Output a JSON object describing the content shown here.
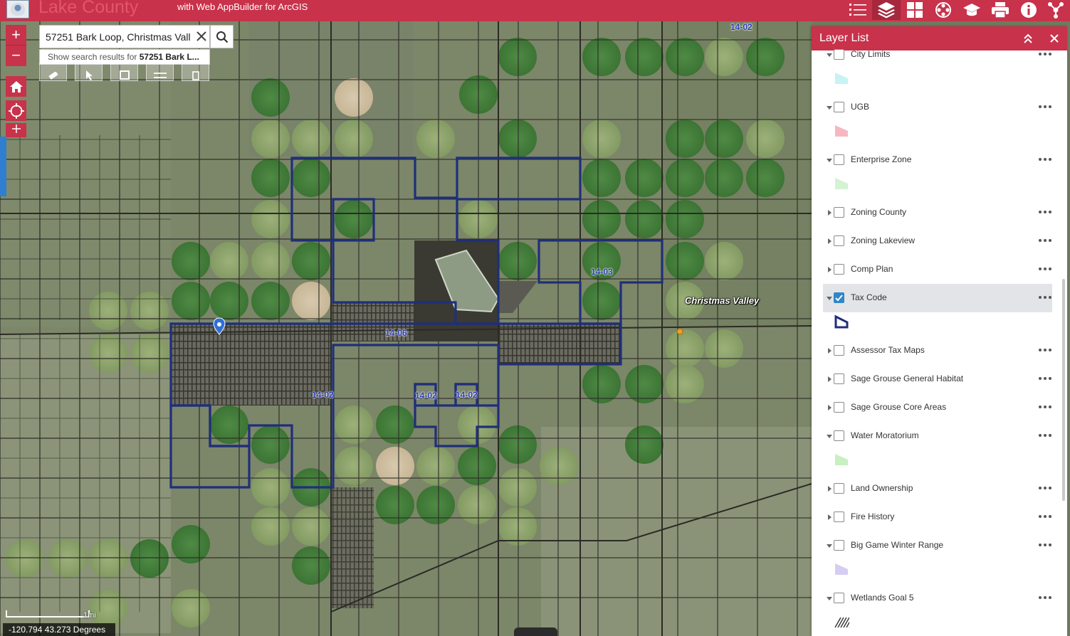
{
  "header": {
    "title": "Lake County",
    "subtitle": "with Web AppBuilder for ArcGIS",
    "toolbar": [
      {
        "name": "legend-icon",
        "active": false
      },
      {
        "name": "layers-icon",
        "active": true
      },
      {
        "name": "basemap-gallery-icon",
        "active": false
      },
      {
        "name": "film-reel-icon",
        "active": false
      },
      {
        "name": "graduation-cap-icon",
        "active": false
      },
      {
        "name": "print-icon",
        "active": false
      },
      {
        "name": "info-icon",
        "active": false
      },
      {
        "name": "share-icon",
        "active": false
      }
    ]
  },
  "search": {
    "value": "57251 Bark Loop, Christmas Vall",
    "suggestion_prefix": "Show search results for ",
    "suggestion_term": "57251 Bark L..."
  },
  "map": {
    "tax_code_labels": [
      "14-02",
      "14-03",
      "14-06",
      "14-02",
      "14-02",
      "14-02"
    ],
    "place_label": "Christmas Valley",
    "scale_label": "1mi",
    "coordinates": "-120.794 43.273 Degrees",
    "zoom_in": "+",
    "zoom_out": "−",
    "colors": {
      "tax_boundary": "#1f2f7a",
      "parcel_lines": "#2a2a26",
      "place_marker": "#f0a020",
      "search_pin": "#2f6fd6"
    }
  },
  "layer_list": {
    "title": "Layer List",
    "layers": [
      {
        "label": "City Limits",
        "expanded": true,
        "checked": false,
        "symbol": "fill",
        "color": "#c8f2f4"
      },
      {
        "label": "UGB",
        "expanded": true,
        "checked": false,
        "symbol": "fill",
        "color": "#f6b8c0"
      },
      {
        "label": "Enterprise Zone",
        "expanded": true,
        "checked": false,
        "symbol": "fill",
        "color": "#d4f2d4"
      },
      {
        "label": "Zoning County",
        "expanded": false,
        "checked": false
      },
      {
        "label": "Zoning Lakeview",
        "expanded": false,
        "checked": false
      },
      {
        "label": "Comp Plan",
        "expanded": false,
        "checked": false
      },
      {
        "label": "Tax Code",
        "expanded": true,
        "checked": true,
        "selected": true,
        "symbol": "outline",
        "color": "#1f2f7a"
      },
      {
        "label": "Assessor Tax Maps",
        "expanded": false,
        "checked": false
      },
      {
        "label": "Sage Grouse General Habitat",
        "expanded": false,
        "checked": false
      },
      {
        "label": "Sage Grouse Core Areas",
        "expanded": false,
        "checked": false
      },
      {
        "label": "Water Moratorium",
        "expanded": true,
        "checked": false,
        "symbol": "fill",
        "color": "#c8f0c0"
      },
      {
        "label": "Land Ownership",
        "expanded": false,
        "checked": false
      },
      {
        "label": "Fire History",
        "expanded": false,
        "checked": false
      },
      {
        "label": "Big Game Winter Range",
        "expanded": true,
        "checked": false,
        "symbol": "fill",
        "color": "#d6cdf2"
      },
      {
        "label": "Wetlands Goal 5",
        "expanded": true,
        "checked": false,
        "symbol": "hatch",
        "color": "#333333"
      }
    ]
  }
}
